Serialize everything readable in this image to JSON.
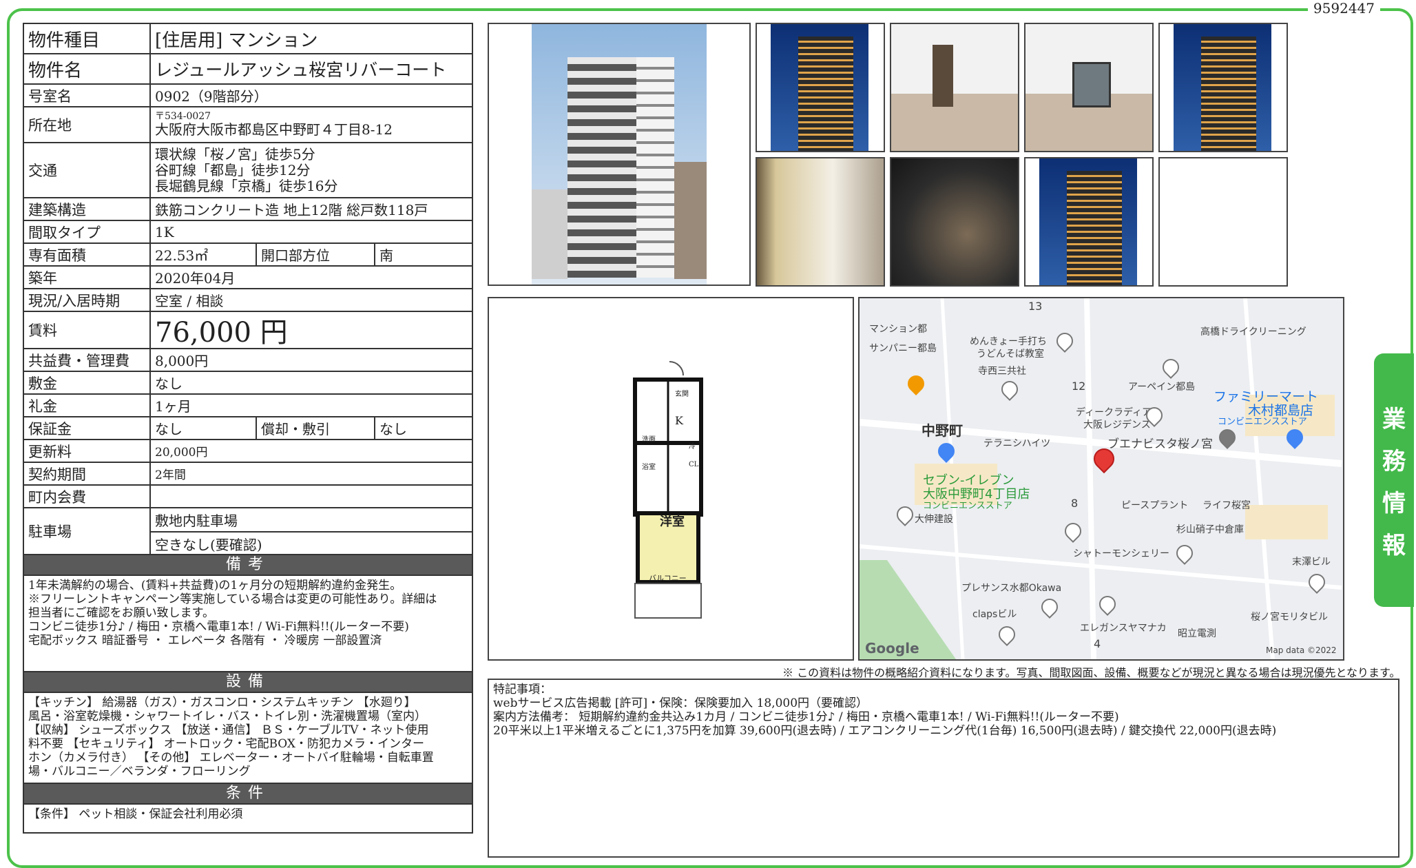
{
  "doc_id": "9592447",
  "side_tab": [
    "業",
    "務",
    "情",
    "報"
  ],
  "table": {
    "type_label": "物件種目",
    "type_value": "[住居用] マンション",
    "name_label": "物件名",
    "name_value": "レジュールアッシュ桜宮リバーコート",
    "room_label": "号室名",
    "room_value": "0902（9階部分）",
    "addr_label": "所在地",
    "postal": "〒534-0027",
    "address": "大阪府大阪市都島区中野町４丁目8-12",
    "access_label": "交通",
    "access": [
      "環状線「桜ノ宮」徒歩5分",
      "谷町線「都島」徒歩12分",
      "長堀鶴見線「京橋」徒歩16分"
    ],
    "struct_label": "建築構造",
    "struct_value": "鉄筋コンクリート造 地上12階 総戸数118戸",
    "layout_label": "間取タイプ",
    "layout_value": "1K",
    "area_label": "専有面積",
    "area_value": "22.53㎡",
    "dir_label": "開口部方位",
    "dir_value": "南",
    "built_label": "築年",
    "built_value": "2020年04月",
    "status_label": "現況/入居時期",
    "status_value": "空室 / 相談",
    "rent_label": "賃料",
    "rent_value": "76,000 円",
    "fee_label": "共益費・管理費",
    "fee_value": "8,000円",
    "deposit_label": "敷金",
    "deposit_value": "なし",
    "key_label": "礼金",
    "key_value": "1ヶ月",
    "guarantee_label": "保証金",
    "guarantee_value": "なし",
    "amort_label": "償却・敷引",
    "amort_value": "なし",
    "renew_label": "更新料",
    "renew_value": "20,000円",
    "term_label": "契約期間",
    "term_value": "2年間",
    "town_label": "町内会費",
    "town_value": "",
    "parking_label": "駐車場",
    "parking_1": "敷地内駐車場",
    "parking_2": "空きなし(要確認)"
  },
  "sections": {
    "remarks_head": "備考",
    "remarks_body": [
      "1年未満解約の場合、(賃料+共益費)の1ヶ月分の短期解約違約金発生。",
      "※フリーレントキャンペーン等実施している場合は変更の可能性あり。詳細は",
      "担当者にご確認をお願い致します。",
      "コンビニ徒歩1分♪ / 梅田・京橋へ電車1本! / Wi-Fi無料!!(ルーター不要)",
      "宅配ボックス 暗証番号 ・ エレベータ 各階有 ・ 冷暖房 一部設置済"
    ],
    "equip_head": "設備",
    "equip_body": [
      "【キッチン】 給湯器（ガス）・ガスコンロ・システムキッチン 【水廻り】",
      "風呂・浴室乾燥機・シャワートイレ・バス・トイレ別・洗濯機置場（室内）",
      "【収納】 シューズボックス 【放送・通信】 ＢＳ・ケーブルTV・ネット使用",
      "料不要 【セキュリティ】 オートロック・宅配BOX・防犯カメラ・インター",
      "ホン（カメラ付き） 【その他】 エレベーター・オートバイ駐輪場・自転車置",
      "場・バルコニー／ベランダ・フローリング"
    ],
    "cond_head": "条件",
    "cond_body": "【条件】 ペット相談・保証会社利用必須"
  },
  "floorplan": {
    "room": "洋室",
    "balcony": "バルコニー",
    "k": "K",
    "toilet": "洗面",
    "bath": "浴室",
    "entry": "玄関",
    "cl": "CL",
    "wash": "冷"
  },
  "map": {
    "labels": [
      "13",
      "12",
      "8",
      "4",
      "マンション都",
      "サンパニー都島",
      "めんきょー手打ち",
      "うどんそば教室",
      "寺西三共社",
      "アーペイン都島",
      "高橋ドライクリーニング",
      "ディークラディア",
      "大阪レジデンス",
      "テラニシハイツ",
      "ブエナビスタ桜ノ宮",
      "大伸建設",
      "ピースプラント",
      "ライフ桜宮",
      "杉山硝子中倉庫",
      "シャトーモンシェリー",
      "末澤ビル",
      "プレサンス水都Okawa",
      "clapsビル",
      "エレガンスヤマナカ",
      "昭立電測",
      "桜ノ宮モリタビル"
    ],
    "station": "中野町",
    "store1_a": "セブン-イレブン",
    "store1_b": "大阪中野町4丁目店",
    "store1_c": "コンビニエンスストア",
    "store2_a": "ファミリーマート",
    "store2_b": "木村都島店",
    "store2_c": "コンビニエンスストア",
    "brand": "Google",
    "credit": "Map data ©2022"
  },
  "notice": "※ この資料は物件の概略紹介資料になります。写真、間取図面、設備、概要などが現況と異なる場合は現況優先となります。",
  "remarks_box": [
    "特記事項：",
    "webサービス広告掲載 [許可]・保険：保険要加入 18,000円（要確認）",
    "案内方法備考： 短期解約違約金共込み1カ月 / コンビニ徒歩1分♪ / 梅田・京橋へ電車1本! / Wi-Fi無料!!(ルーター不要)",
    "20平米以上1平米増えるごとに1,375円を加算 39,600円(退去時) / エアコンクリーニング代(1台毎) 16,500円(退去時) / 鍵交換代 22,000円(退去時)"
  ]
}
